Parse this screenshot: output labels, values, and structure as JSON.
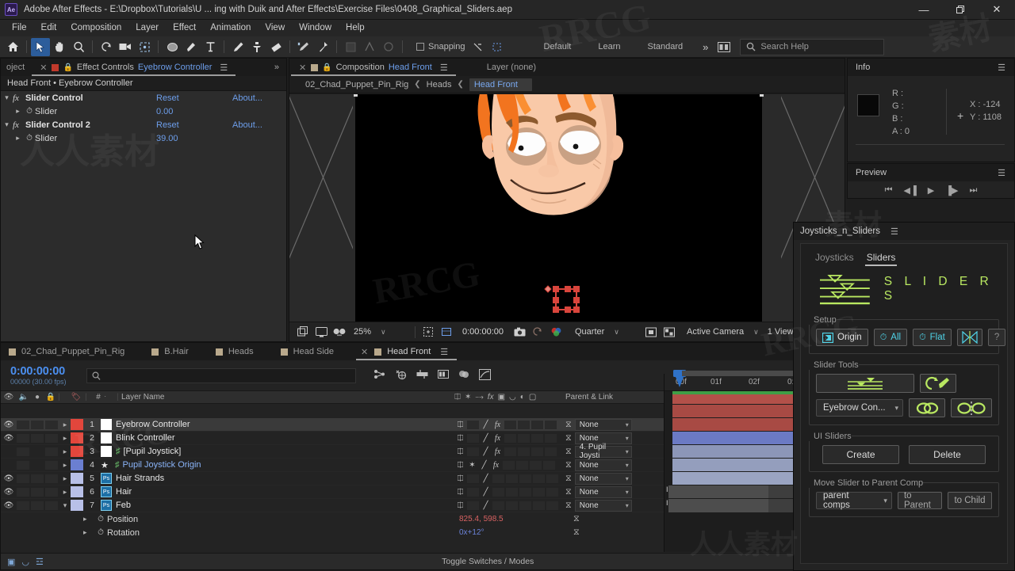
{
  "window": {
    "app_badge": "Ae",
    "title": "Adobe After Effects - E:\\Dropbox\\Tutorials\\U ... ing with Duik and After Effects\\Exercise Files\\0408_Graphical_Sliders.aep",
    "minimize": "—",
    "restore": "❐",
    "close": "✕"
  },
  "menubar": [
    "File",
    "Edit",
    "Composition",
    "Layer",
    "Effect",
    "Animation",
    "View",
    "Window",
    "Help"
  ],
  "toolbar": {
    "snapping_label": "Snapping",
    "workspaces": [
      "Default",
      "Learn",
      "Standard"
    ],
    "more_chevron": "»",
    "search_placeholder": "Search Help",
    "search_icon": "search-icon"
  },
  "effect_controls": {
    "tab_project": "oject",
    "tab_close": "✕",
    "tab_label": "Effect Controls",
    "tab_comp": "Eyebrow Controller",
    "expand_chevron": "»",
    "breadcrumb": "Head Front • Eyebrow Controller",
    "effects": [
      {
        "name": "Slider Control",
        "reset": "Reset",
        "about": "About...",
        "prop": "Slider",
        "value": "0.00"
      },
      {
        "name": "Slider Control 2",
        "reset": "Reset",
        "about": "About...",
        "prop": "Slider",
        "value": "39.00"
      }
    ]
  },
  "comp_panel": {
    "tab_close": "✕",
    "tab_label": "Composition",
    "tab_comp": "Head Front",
    "layer_label": "Layer (none)",
    "breadcrumbs": [
      "02_Chad_Puppet_Pin_Rig",
      "Heads",
      "Head Front"
    ],
    "bottombar": {
      "zoom": "25%",
      "time": "0:00:00:00",
      "resolution": "Quarter",
      "camera": "Active Camera",
      "views": "1 View",
      "chevron": "∨"
    }
  },
  "info_panel": {
    "title": "Info",
    "labels": {
      "r": "R :",
      "g": "G :",
      "b": "B :",
      "a": "A :",
      "x": "X :",
      "y": "Y :"
    },
    "values": {
      "r": "",
      "g": "",
      "b": "",
      "a": "0",
      "x": "-124",
      "y": "1108"
    }
  },
  "preview_panel": {
    "title": "Preview",
    "controls": [
      "first-frame-icon",
      "prev-frame-icon",
      "play-icon",
      "next-frame-icon",
      "last-frame-icon"
    ]
  },
  "jns_panel": {
    "title": "Joysticks_n_Sliders",
    "tabs": [
      {
        "label": "Joysticks",
        "active": false
      },
      {
        "label": "Sliders",
        "active": true
      }
    ],
    "banner_word": "S L I D E R S",
    "groups": {
      "setup": {
        "label": "Setup",
        "buttons": [
          {
            "label": "Origin",
            "icon": "origin-icon",
            "style": "white"
          },
          {
            "label": "All",
            "icon": "stopwatch-icon",
            "style": "cyan"
          },
          {
            "label": "Flat",
            "icon": "stopwatch-icon",
            "style": "cyan"
          },
          {
            "label": "",
            "icon": "mirror-icon",
            "style": "cyan"
          },
          {
            "label": "?",
            "icon": "help-icon",
            "style": "dim"
          }
        ]
      },
      "slider_tools": {
        "label": "Slider Tools",
        "create_slider_icon": "slider-lines-icon",
        "edit_icon": "rotate-pen-icon",
        "dropdown_value": "Eyebrow Con...",
        "link_icon": "chain-link-icon",
        "split_icon": "split-circles-icon"
      },
      "ui_sliders": {
        "label": "UI Sliders",
        "create": "Create",
        "delete": "Delete"
      },
      "move_slider": {
        "label": "Move Slider to Parent Comp",
        "dropdown_value": "parent comps",
        "to_parent": "to Parent",
        "to_child": "to Child"
      }
    },
    "accent_color": "#b9e861"
  },
  "timeline": {
    "tabs": [
      {
        "label": "02_Chad_Puppet_Pin_Rig",
        "active": false
      },
      {
        "label": "B.Hair",
        "active": false
      },
      {
        "label": "Heads",
        "active": false
      },
      {
        "label": "Head Side",
        "active": false
      },
      {
        "label": "Head Front",
        "active": true
      }
    ],
    "time_code": "0:00:00:00",
    "frame_info": "00000 (30.00 fps)",
    "search_icon": "search-icon",
    "column_headers": {
      "layer_name": "Layer Name",
      "num": "#",
      "parent_link": "Parent & Link"
    },
    "layers": [
      {
        "num": "1",
        "name": "Eyebrow Controller",
        "color": "#e2463c",
        "visible": true,
        "selected": true,
        "has_fx": true,
        "parent": "None",
        "type": "solid",
        "track_color": "#b35049"
      },
      {
        "num": "2",
        "name": "Blink Controller",
        "color": "#e2463c",
        "visible": true,
        "selected": false,
        "has_fx": true,
        "parent": "None",
        "type": "solid",
        "track_color": "#a84a44"
      },
      {
        "num": "3",
        "name": "[Pupil Joystick]",
        "color": "#e2463c",
        "visible": false,
        "selected": false,
        "has_fx": true,
        "parent": "4. Pupil Joysti",
        "type": "null",
        "track_color": "#a84a44"
      },
      {
        "num": "4",
        "name": "Pupil Joystick Origin",
        "color": "#6b7fd1",
        "visible": false,
        "selected": false,
        "has_fx": true,
        "parent": "None",
        "type": "null-star",
        "track_color": "#6b7ac4"
      },
      {
        "num": "5",
        "name": "Hair Strands",
        "color": "#b8c0e8",
        "visible": true,
        "selected": false,
        "has_fx": false,
        "parent": "None",
        "type": "psd",
        "track_color": "#8c96b8"
      },
      {
        "num": "6",
        "name": "Hair",
        "color": "#b8c0e8",
        "visible": true,
        "selected": false,
        "has_fx": false,
        "parent": "None",
        "type": "psd",
        "track_color": "#949ebd"
      },
      {
        "num": "7",
        "name": "Feb",
        "color": "#b8c0e8",
        "visible": true,
        "selected": false,
        "has_fx": false,
        "parent": "None",
        "type": "psd",
        "expanded": true,
        "track_color": "#9aa4c2"
      }
    ],
    "properties": [
      "Position",
      "Rotation"
    ],
    "ruler_ticks": [
      "00f",
      "01f",
      "02f",
      "0:"
    ],
    "status_text": "Toggle Switches / Modes",
    "expression_values": [
      "825.4, 598.5",
      "0x+12°"
    ]
  },
  "watermarks": [
    "RRCG",
    "人人素材",
    "RRCG",
    "素材",
    "RRCG"
  ]
}
